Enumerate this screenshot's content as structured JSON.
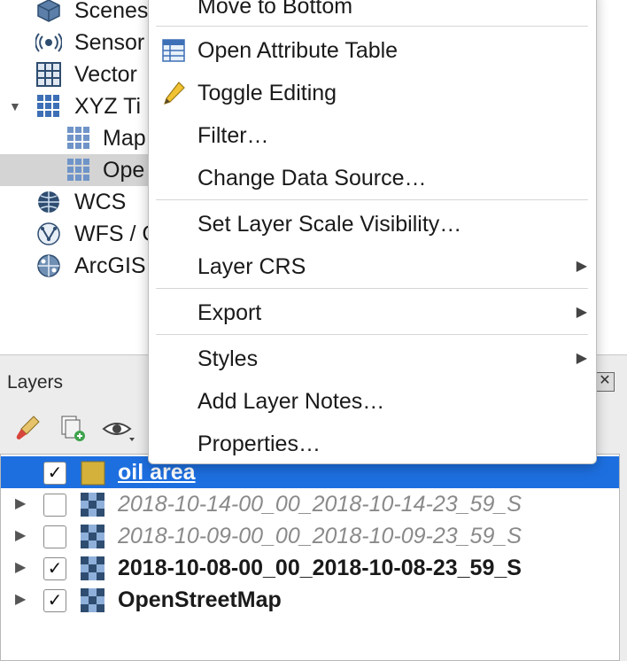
{
  "browser": {
    "items": [
      {
        "label": "Scenes",
        "icon": "scenes-icon"
      },
      {
        "label": "Sensor",
        "icon": "sensor-icon"
      },
      {
        "label": "Vector",
        "icon": "vector-tiles-icon"
      },
      {
        "label": "XYZ Ti",
        "icon": "xyz-tiles-icon",
        "expanded": true
      },
      {
        "label": "Map",
        "icon": "tile-grid-icon"
      },
      {
        "label": "Ope",
        "icon": "tile-grid-icon",
        "selected": true
      },
      {
        "label": "WCS",
        "icon": "wcs-globe-icon"
      },
      {
        "label": "WFS / C",
        "icon": "wfs-icon"
      },
      {
        "label": "ArcGIS",
        "icon": "arcgis-icon"
      }
    ]
  },
  "context_menu": {
    "items": [
      {
        "label": "Move to Bottom",
        "icon": ""
      },
      {
        "label": "Open Attribute Table",
        "icon": "attribute-table-icon"
      },
      {
        "label": "Toggle Editing",
        "icon": "pencil-icon"
      },
      {
        "label": "Filter…",
        "icon": ""
      },
      {
        "label": "Change Data Source…",
        "icon": ""
      },
      {
        "label": "Set Layer Scale Visibility…",
        "icon": ""
      },
      {
        "label": "Layer CRS",
        "icon": "",
        "submenu": true
      },
      {
        "label": "Export",
        "icon": "",
        "submenu": true
      },
      {
        "label": "Styles",
        "icon": "",
        "submenu": true
      },
      {
        "label": "Add Layer Notes…",
        "icon": ""
      },
      {
        "label": "Properties…",
        "icon": ""
      }
    ]
  },
  "layers_panel": {
    "title": "Layers",
    "close_icon": "close-icon",
    "toolbar": [
      "style-brush-icon",
      "add-group-icon",
      "visibility-eye-icon"
    ],
    "layers": [
      {
        "name": "oil area",
        "checked": true,
        "selected": true,
        "icon": "polygon-layer-icon"
      },
      {
        "name": "2018-10-14-00_00_2018-10-14-23_59_S",
        "checked": false,
        "icon": "raster-layer-icon"
      },
      {
        "name": "2018-10-09-00_00_2018-10-09-23_59_S",
        "checked": false,
        "icon": "raster-layer-icon"
      },
      {
        "name": "2018-10-08-00_00_2018-10-08-23_59_S",
        "checked": true,
        "icon": "raster-layer-icon"
      },
      {
        "name": "OpenStreetMap",
        "checked": true,
        "icon": "raster-layer-icon"
      }
    ]
  },
  "colors": {
    "selection": "#1d6fe0",
    "polygon_fill": "#d4b13a",
    "tile_blue": "#3d6fb6"
  },
  "glyphs": {
    "check": "✓",
    "expander_right": "▶",
    "expander_down": "▼",
    "submenu_arrow": "▶",
    "close": "✕"
  }
}
